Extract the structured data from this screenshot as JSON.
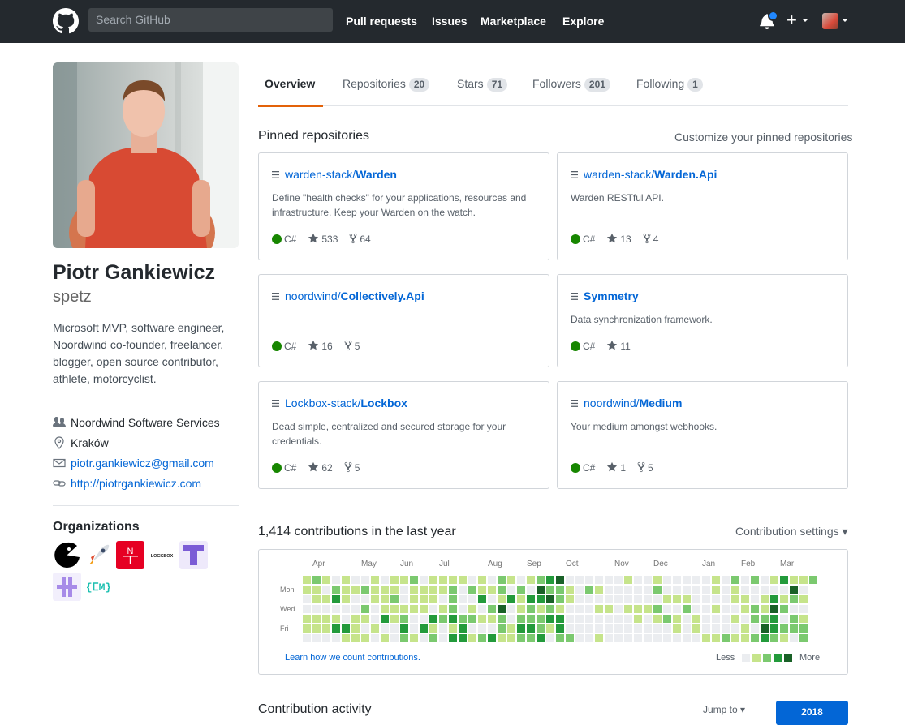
{
  "header": {
    "search_placeholder": "Search GitHub",
    "nav": [
      "Pull requests",
      "Issues",
      "Marketplace",
      "Explore"
    ],
    "plus_label": "+"
  },
  "profile": {
    "fullname": "Piotr Gankiewicz",
    "username": "spetz",
    "bio": "Microsoft MVP, software engineer, Noordwind co-founder, freelancer, blogger, open source contributor, athlete, motorcyclist.",
    "company": "Noordwind Software Services",
    "location": "Kraków",
    "email": "piotr.gankiewicz@gmail.com",
    "website": "http://piotrgankiewicz.com",
    "orgs_title": "Organizations",
    "orgs": [
      {
        "icon": "pacman-org-icon",
        "color": "#000000"
      },
      {
        "icon": "rocket-org-icon",
        "color": "#ffffff"
      },
      {
        "icon": "noordwind-org-icon",
        "color": "#e60023",
        "text": "N"
      },
      {
        "icon": "lockbox-org-icon",
        "color": "#ffffff",
        "text": "LOCKBOX"
      },
      {
        "icon": "t-org-icon",
        "color": "#7b5cd6"
      },
      {
        "icon": "plus-org-icon",
        "color": "#a78be8"
      },
      {
        "icon": "dm-org-icon",
        "color": "#1bbfb0",
        "text": "{ⵎM}"
      }
    ]
  },
  "tabs": [
    {
      "label": "Overview",
      "count": null
    },
    {
      "label": "Repositories",
      "count": "20"
    },
    {
      "label": "Stars",
      "count": "71"
    },
    {
      "label": "Followers",
      "count": "201"
    },
    {
      "label": "Following",
      "count": "1"
    }
  ],
  "pinned": {
    "title": "Pinned repositories",
    "customize": "Customize your pinned repositories",
    "repos": [
      {
        "owner": "warden-stack/",
        "name": "Warden",
        "desc": "Define \"health checks\" for your applications, resources and infrastructure. Keep your Warden on the watch.",
        "lang": "C#",
        "stars": "533",
        "forks": "64"
      },
      {
        "owner": "warden-stack/",
        "name": "Warden.Api",
        "desc": "Warden RESTful API.",
        "lang": "C#",
        "stars": "13",
        "forks": "4"
      },
      {
        "owner": "noordwind/",
        "name": "Collectively.Api",
        "desc": "",
        "lang": "C#",
        "stars": "16",
        "forks": "5"
      },
      {
        "owner": "",
        "name": "Symmetry",
        "desc": "Data synchronization framework.",
        "lang": "C#",
        "stars": "11",
        "forks": ""
      },
      {
        "owner": "Lockbox-stack/",
        "name": "Lockbox",
        "desc": "Dead simple, centralized and secured storage for your credentials.",
        "lang": "C#",
        "stars": "62",
        "forks": "5"
      },
      {
        "owner": "noordwind/",
        "name": "Medium",
        "desc": "Your medium amongst webhooks.",
        "lang": "C#",
        "stars": "1",
        "forks": "5"
      }
    ]
  },
  "contributions": {
    "title": "1,414 contributions in the last year",
    "settings": "Contribution settings ▾",
    "months": [
      "Apr",
      "May",
      "Jun",
      "Jul",
      "Aug",
      "Sep",
      "Oct",
      "Nov",
      "Dec",
      "Jan",
      "Feb",
      "Mar"
    ],
    "days": [
      "Mon",
      "Wed",
      "Fri"
    ],
    "learn": "Learn how we count contributions.",
    "less": "Less",
    "more": "More",
    "levels": [
      "#ebedf0",
      "#c6e48b",
      "#7bc96f",
      "#239a3b",
      "#196127"
    ]
  },
  "activity": {
    "title": "Contribution activity",
    "jump": "Jump to ▾",
    "year": "2018"
  }
}
